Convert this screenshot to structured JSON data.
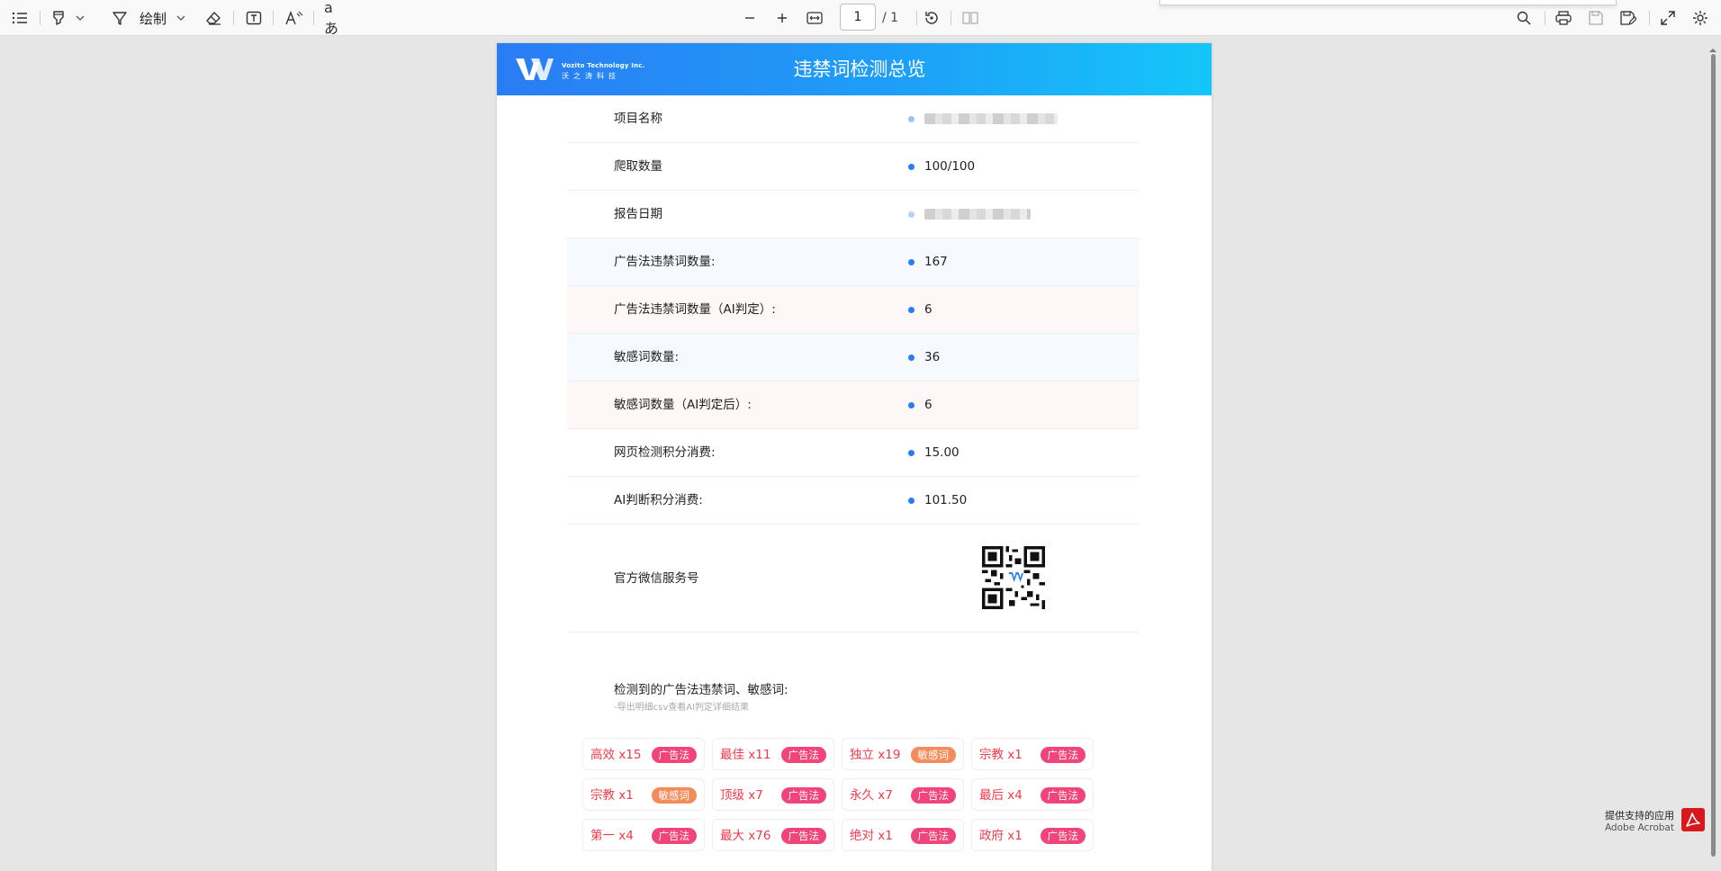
{
  "toolbar": {
    "draw_label": "绘制",
    "page_number": "1",
    "page_total": "/ 1",
    "icons": [
      "list-icon",
      "highlight-icon",
      "draw-icon",
      "eraser-icon",
      "text-box-icon",
      "read-aloud-icon",
      "translate-icon",
      "zoom-out-icon",
      "zoom-in-icon",
      "fit-width-icon",
      "rotate-icon",
      "page-view-icon",
      "search-icon",
      "print-icon",
      "save-icon",
      "save-as-icon",
      "fullscreen-icon",
      "settings-icon"
    ]
  },
  "colors": {
    "banner_start": "#2a7cf4",
    "banner_end": "#15c6f9",
    "accent_dot": "#2a7cf4",
    "tag_text": "#f0394a",
    "badge_ad": "#f0447a",
    "badge_sensitive": "#f48b5a"
  },
  "document": {
    "logo_en": "Vozito Technology Inc.",
    "logo_cn": "沃之涛科技",
    "title": "违禁词检测总览",
    "rows": [
      {
        "label": "项目名称",
        "value": ""
      },
      {
        "label": "爬取数量",
        "value": "100/100"
      },
      {
        "label": "报告日期",
        "value": ""
      },
      {
        "label": "广告法违禁词数量:",
        "value": "167"
      },
      {
        "label": "广告法违禁词数量（AI判定）:",
        "value": "6"
      },
      {
        "label": "敏感词数量:",
        "value": "36"
      },
      {
        "label": "敏感词数量（AI判定后）:",
        "value": "6"
      },
      {
        "label": "网页检测积分消费:",
        "value": "15.00"
      },
      {
        "label": "AI判断积分消费:",
        "value": "101.50"
      },
      {
        "label": "官方微信服务号",
        "value": ""
      }
    ],
    "section_title": "检测到的广告法违禁词、敏感词:",
    "section_subtitle": "-导出明细csv查看AI判定详细结果",
    "tags": [
      {
        "word": "高效 x15",
        "badge": "广告法",
        "kind": "ad"
      },
      {
        "word": "最佳 x11",
        "badge": "广告法",
        "kind": "ad"
      },
      {
        "word": "独立 x19",
        "badge": "敏感词",
        "kind": "sensitive"
      },
      {
        "word": "宗教 x1",
        "badge": "广告法",
        "kind": "ad"
      },
      {
        "word": "宗教 x1",
        "badge": "敏感词",
        "kind": "sensitive"
      },
      {
        "word": "顶级 x7",
        "badge": "广告法",
        "kind": "ad"
      },
      {
        "word": "永久 x7",
        "badge": "广告法",
        "kind": "ad"
      },
      {
        "word": "最后 x4",
        "badge": "广告法",
        "kind": "ad"
      },
      {
        "word": "第一 x4",
        "badge": "广告法",
        "kind": "ad"
      },
      {
        "word": "最大 x76",
        "badge": "广告法",
        "kind": "ad"
      },
      {
        "word": "绝对 x1",
        "badge": "广告法",
        "kind": "ad"
      },
      {
        "word": "政府 x1",
        "badge": "广告法",
        "kind": "ad"
      }
    ]
  },
  "acrobat": {
    "line1": "提供支持的应用",
    "line2": "Adobe Acrobat"
  }
}
